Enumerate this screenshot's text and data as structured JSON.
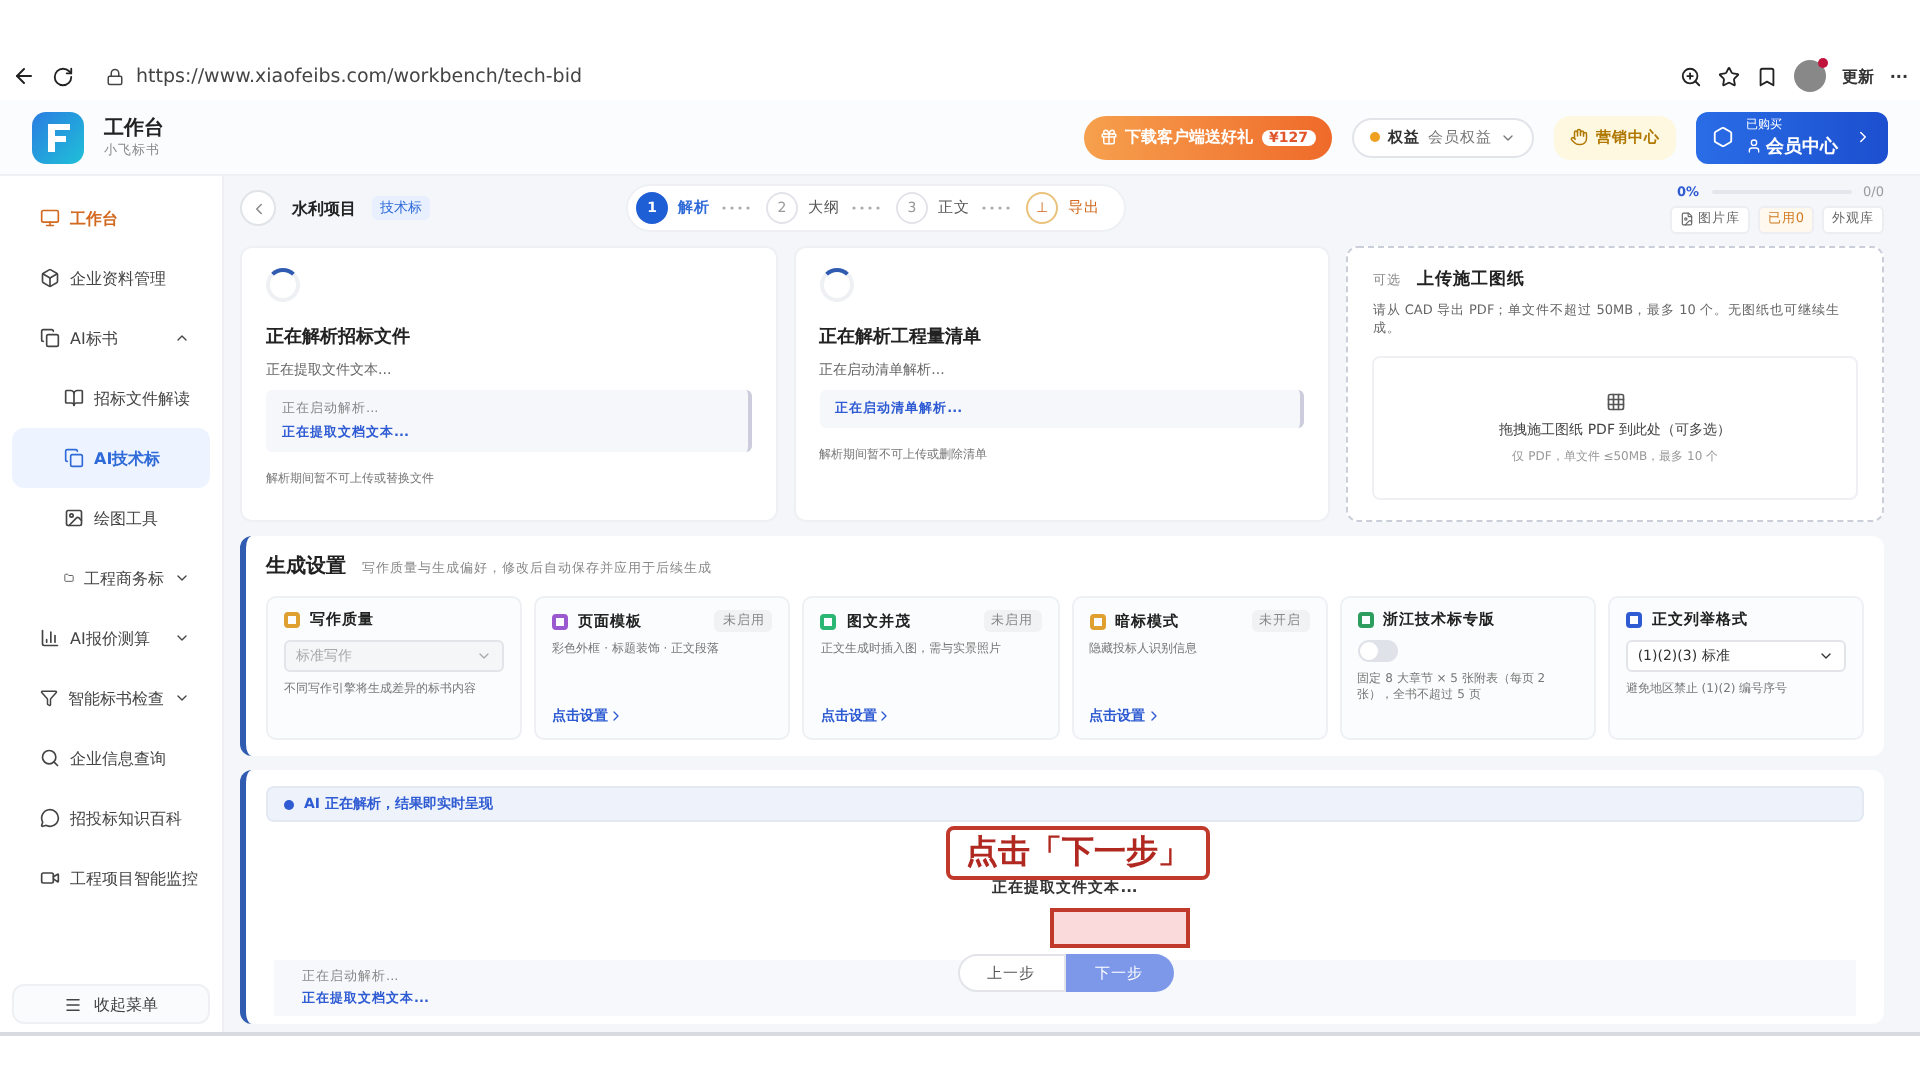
{
  "browser": {
    "url": "https://www.xiaofeibs.com/workbench/tech-bid",
    "update": "更新",
    "more": "···"
  },
  "header": {
    "title": "工作台",
    "subtitle": "小飞标书",
    "promo": "下载客户端送好礼",
    "promo_badge": "¥127",
    "rights_label": "权益",
    "rights_value": "会员权益",
    "marketing": "营销中心",
    "member_top": "已购买",
    "member": "会员中心"
  },
  "sidebar": {
    "items": [
      {
        "label": "工作台",
        "selected": false,
        "active": true
      },
      {
        "label": "企业资料管理",
        "selected": false,
        "active": false
      },
      {
        "label": "AI标书",
        "selected": false,
        "active": false,
        "expanded": true,
        "children": [
          {
            "label": "招标文件解读",
            "selected": false,
            "active": false
          },
          {
            "label": "AI技术标",
            "selected": true,
            "active": false
          },
          {
            "label": "绘图工具",
            "selected": false,
            "active": false
          },
          {
            "label": "工程商务标",
            "selected": false,
            "active": false,
            "expanded": false
          }
        ]
      },
      {
        "label": "AI报价测算",
        "selected": false,
        "active": false,
        "expanded": false
      },
      {
        "label": "智能标书检查",
        "selected": false,
        "active": false,
        "expanded": false
      },
      {
        "label": "企业信息查询",
        "selected": false,
        "active": false
      },
      {
        "label": "招投标知识百科",
        "selected": false,
        "active": false
      },
      {
        "label": "工程项目智能监控",
        "selected": false,
        "active": false
      }
    ],
    "collapse": "收起菜单"
  },
  "project": {
    "name": "水利项目",
    "tag": "技术标"
  },
  "steps": [
    {
      "number": "1",
      "label": "解析",
      "selected": true
    },
    {
      "number": "2",
      "label": "大纲",
      "selected": false
    },
    {
      "number": "3",
      "label": "正文",
      "selected": false
    },
    {
      "number": "⊥",
      "label": "导出",
      "selected": false
    }
  ],
  "progress": {
    "percent": "0%",
    "count": "0/0",
    "level": 0
  },
  "tools": [
    {
      "label": "图片库",
      "kind": "plain"
    },
    {
      "label": "已用0",
      "kind": "warn"
    },
    {
      "label": "外观库",
      "kind": "plain"
    }
  ],
  "cards": [
    {
      "kind": "parse",
      "title": "正在解析招标文件",
      "status": "正在提取文件文本...",
      "logs": [
        {
          "text": "正在启动解析...",
          "kind": "muted"
        },
        {
          "text": "正在提取文档文本...",
          "kind": "link"
        }
      ],
      "note": "解析期间暂不可上传或替换文件"
    },
    {
      "kind": "parse",
      "title": "正在解析工程量清单",
      "status": "正在启动清单解析...",
      "logs": [
        {
          "text": "正在启动清单解析...",
          "kind": "link"
        }
      ],
      "note": "解析期间暂不可上传或删除清单"
    },
    {
      "kind": "upload",
      "tag": "可选",
      "title": "上传施工图纸",
      "desc": "请从 CAD 导出 PDF；单文件不超过 50MB，最多 10 个。无图纸也可继续生成。",
      "drop": "拖拽施工图纸 PDF 到此处（可多选）",
      "limit": "仅 PDF，单文件 ≤50MB，最多 10 个"
    }
  ],
  "settings": {
    "title": "生成设置",
    "subtitle": "写作质量与生成偏好，修改后自动保存并应用于后续生成",
    "options": [
      {
        "kind": "select",
        "title": "写作质量",
        "value": "标准写作",
        "disabled": true,
        "note": "不同写作引擎将生成差异的标书内容"
      },
      {
        "kind": "link",
        "title": "页面模板",
        "badge": "未启用",
        "note": "彩色外框 · 标题装饰 · 正文段落",
        "link": "点击设置"
      },
      {
        "kind": "link",
        "title": "图文并茂",
        "badge": "未启用",
        "note": "正文生成时插入图，需与实景照片",
        "link": "点击设置"
      },
      {
        "kind": "link",
        "title": "暗标模式",
        "badge": "未开启",
        "note": "隐藏投标人识别信息",
        "link": "点击设置"
      },
      {
        "kind": "toggle",
        "title": "浙江技术标专版",
        "on": false,
        "note": "固定 8 大章节 × 5 张附表（每页 2 张），全书不超过 5 页"
      },
      {
        "kind": "select",
        "title": "正文列举格式",
        "value": "(1)(2)(3) 标准",
        "disabled": false,
        "note": "避免地区禁止 (1)(2) 编号序号"
      }
    ]
  },
  "stream": {
    "banner": "AI 正在解析，结果即实时呈现",
    "status": "正在提取文件文本...",
    "logs": [
      {
        "text": "正在启动解析...",
        "kind": "muted"
      },
      {
        "text": "正在提取文档文本...",
        "kind": "link"
      }
    ],
    "prev": "上一步",
    "next": "下一步"
  },
  "callout": {
    "text": "点击「下一步」"
  }
}
